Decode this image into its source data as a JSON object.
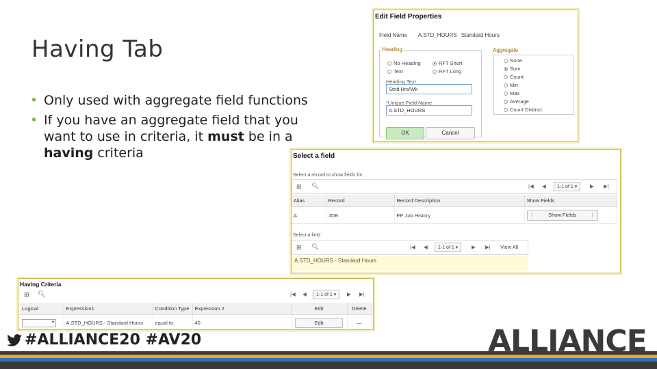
{
  "slide": {
    "title": "Having Tab",
    "bullets": [
      {
        "parts": [
          "Only used with aggregate field functions"
        ]
      },
      {
        "before": "If you have an aggregate field that you want to use in criteria, it ",
        "bold1": "must",
        "middle": " be in a ",
        "bold2": "having",
        "after": " criteria"
      }
    ],
    "bullet_glyph": "•"
  },
  "edit_field": {
    "title": "Edit Field Properties",
    "field_name_label": "Field Name",
    "field_name_value": "A.STD_HOURS",
    "field_name_desc": "Standard Hours",
    "heading_group": "Heading",
    "heading_options": [
      "No Heading",
      "Text",
      "RFT Short",
      "RFT Long"
    ],
    "heading_selected": "RFT Short",
    "heading_text_label": "Heading Text",
    "heading_text_value": "Stnd Hrs/Wk",
    "unique_label": "*Unique Field Name",
    "unique_value": "A.STD_HOURS",
    "aggregate_group": "Aggregate",
    "aggregate_options": [
      "None",
      "Sum",
      "Count",
      "Min",
      "Max",
      "Average",
      "Count Distinct"
    ],
    "aggregate_selected": "Sum",
    "ok_label": "OK",
    "cancel_label": "Cancel"
  },
  "select_field": {
    "title": "Select a field",
    "record_label": "Select a record to show fields for",
    "pager1": "1-1 of 1",
    "columns": [
      "Alias",
      "Record",
      "Record Description",
      "Show Fields"
    ],
    "rows": [
      {
        "alias": "A",
        "record": "JOB",
        "desc": "EE Job History",
        "action": "Show Fields"
      }
    ],
    "field_label": "Select a field",
    "pager2": "1-1 of 1",
    "view_all": "View All",
    "selected_field": "A.STD_HOURS - Standard Hours"
  },
  "having": {
    "title": "Having Criteria",
    "pager": "1-1 of 1",
    "columns": [
      "Logical",
      "Expression1",
      "Condition Type",
      "Expression 2",
      "Edit",
      "Delete"
    ],
    "row": {
      "expr1": "A.STD_HOURS - Standard Hours",
      "cond": "equal to",
      "expr2": "40",
      "edit": "Edit",
      "delete": "—"
    }
  },
  "footer": {
    "hashtags": "#ALLIANCE20 #AV20",
    "logo": "ALLIANCE",
    "stripe_colors": [
      "#3a3a3a",
      "#f2a41c",
      "#2e75b6",
      "#3a3a3a"
    ]
  },
  "icons": [
    "twitter-bird-icon",
    "search-icon",
    "personalize-icon",
    "first-page-icon",
    "prev-page-icon",
    "next-page-icon",
    "last-page-icon",
    "dropdown-arrow-icon",
    "menu-dots-icon"
  ]
}
